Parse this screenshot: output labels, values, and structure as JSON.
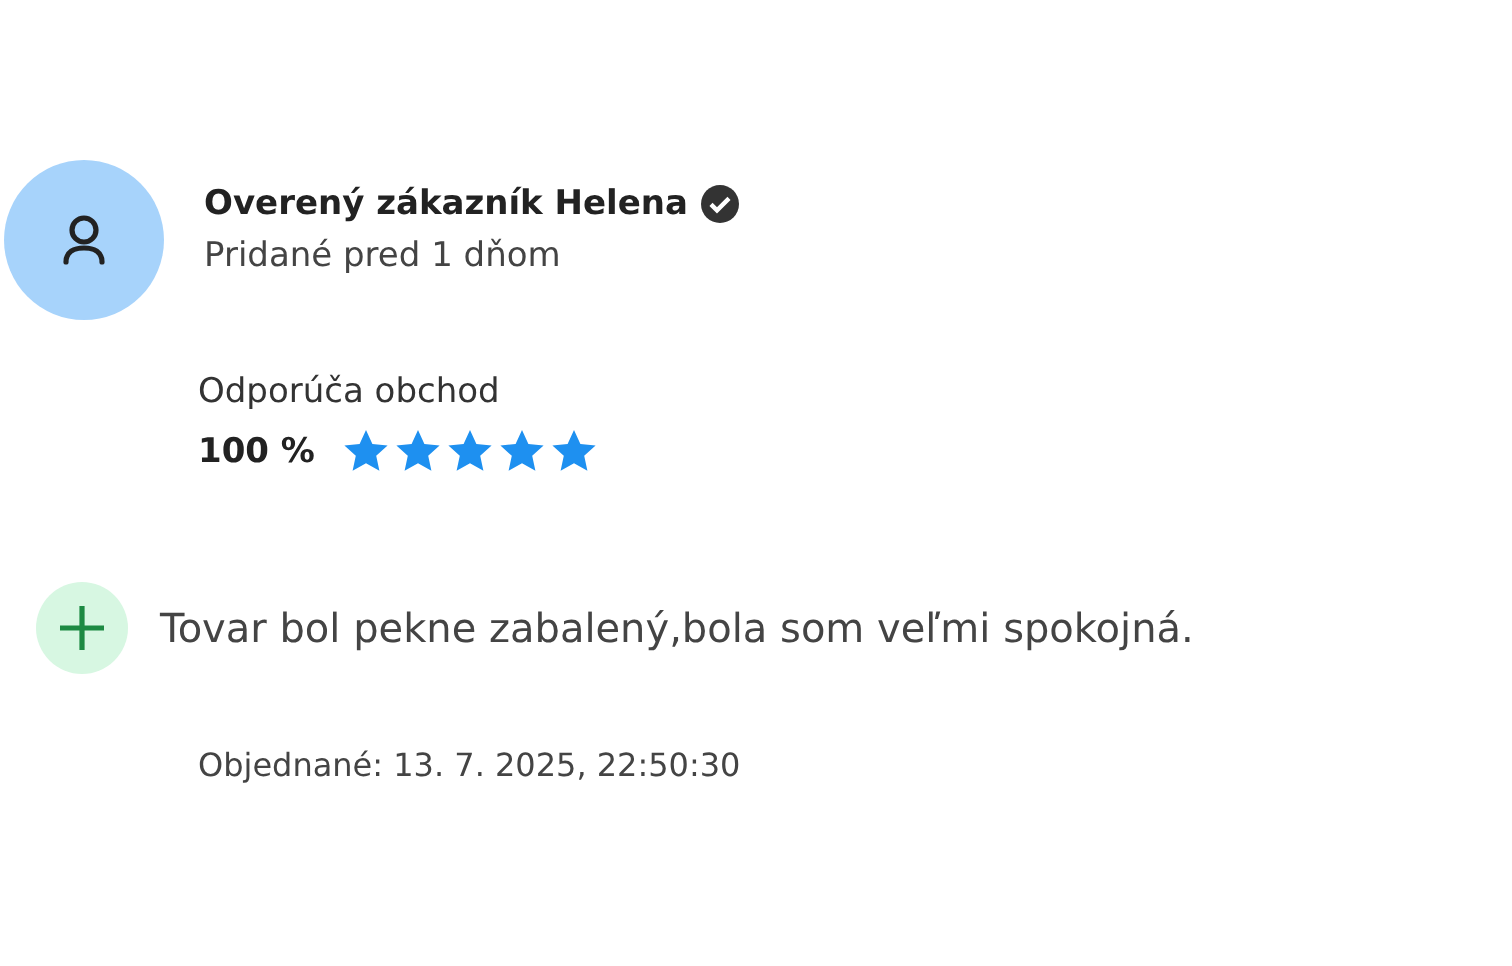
{
  "review": {
    "author": "Overený zákazník Helena",
    "verified": true,
    "added": "Pridané pred 1 dňom",
    "recommend_label": "Odporúča obchod",
    "percent": "100 %",
    "stars": 5,
    "pros": [
      {
        "kind": "plus",
        "text": "Tovar bol pekne zabalený,bola som veľmi spokojná."
      }
    ],
    "ordered": "Objednané: 13. 7. 2025, 22:50:30"
  }
}
